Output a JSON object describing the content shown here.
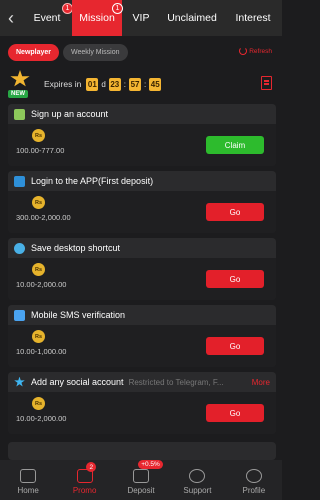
{
  "nav": {
    "tabs": [
      {
        "label": "Event",
        "badge": "1",
        "active": false
      },
      {
        "label": "Mission",
        "badge": "1",
        "active": true
      },
      {
        "label": "VIP",
        "badge": "",
        "active": false
      },
      {
        "label": "Unclaimed",
        "badge": "",
        "active": false
      },
      {
        "label": "Interest",
        "badge": "",
        "active": false
      }
    ]
  },
  "subtabs": {
    "active": "Newplayer",
    "inactive": "Weekly Mission"
  },
  "refresh_label": "Refresh",
  "badge_new": "NEW",
  "expiry": {
    "label": "Expires in",
    "days": "01",
    "d": "d",
    "hours": "23",
    "minutes": "57",
    "seconds": "45",
    "sep": ":"
  },
  "missions": [
    {
      "title": "Sign up an account",
      "sub": "",
      "more": "",
      "coin": "Rs",
      "reward": "100.00-777.00",
      "button": "Claim"
    },
    {
      "title": "Login to the APP(First deposit)",
      "sub": "",
      "more": "",
      "coin": "Rs",
      "reward": "300.00-2,000.00",
      "button": "Go"
    },
    {
      "title": "Save desktop shortcut",
      "sub": "",
      "more": "",
      "coin": "Rs",
      "reward": "10.00-2,000.00",
      "button": "Go"
    },
    {
      "title": "Mobile SMS verification",
      "sub": "",
      "more": "",
      "coin": "Rs",
      "reward": "10.00-1,000.00",
      "button": "Go"
    },
    {
      "title": "Add any social account",
      "sub": "Restricted to Telegram, F...",
      "more": "More",
      "coin": "Rs",
      "reward": "10.00-2,000.00",
      "button": "Go"
    }
  ],
  "bottom_nav": [
    {
      "label": "Home",
      "badge": "",
      "active": false
    },
    {
      "label": "Promo",
      "badge": "2",
      "active": true
    },
    {
      "label": "Deposit",
      "badge": "+0.5%",
      "active": false
    },
    {
      "label": "Support",
      "badge": "",
      "active": false
    },
    {
      "label": "Profile",
      "badge": "",
      "active": false
    }
  ],
  "colors": {
    "accent": "#e7272f",
    "claim": "#2dbb2d",
    "coin": "#e6b32c",
    "timer": "#f4b532"
  }
}
